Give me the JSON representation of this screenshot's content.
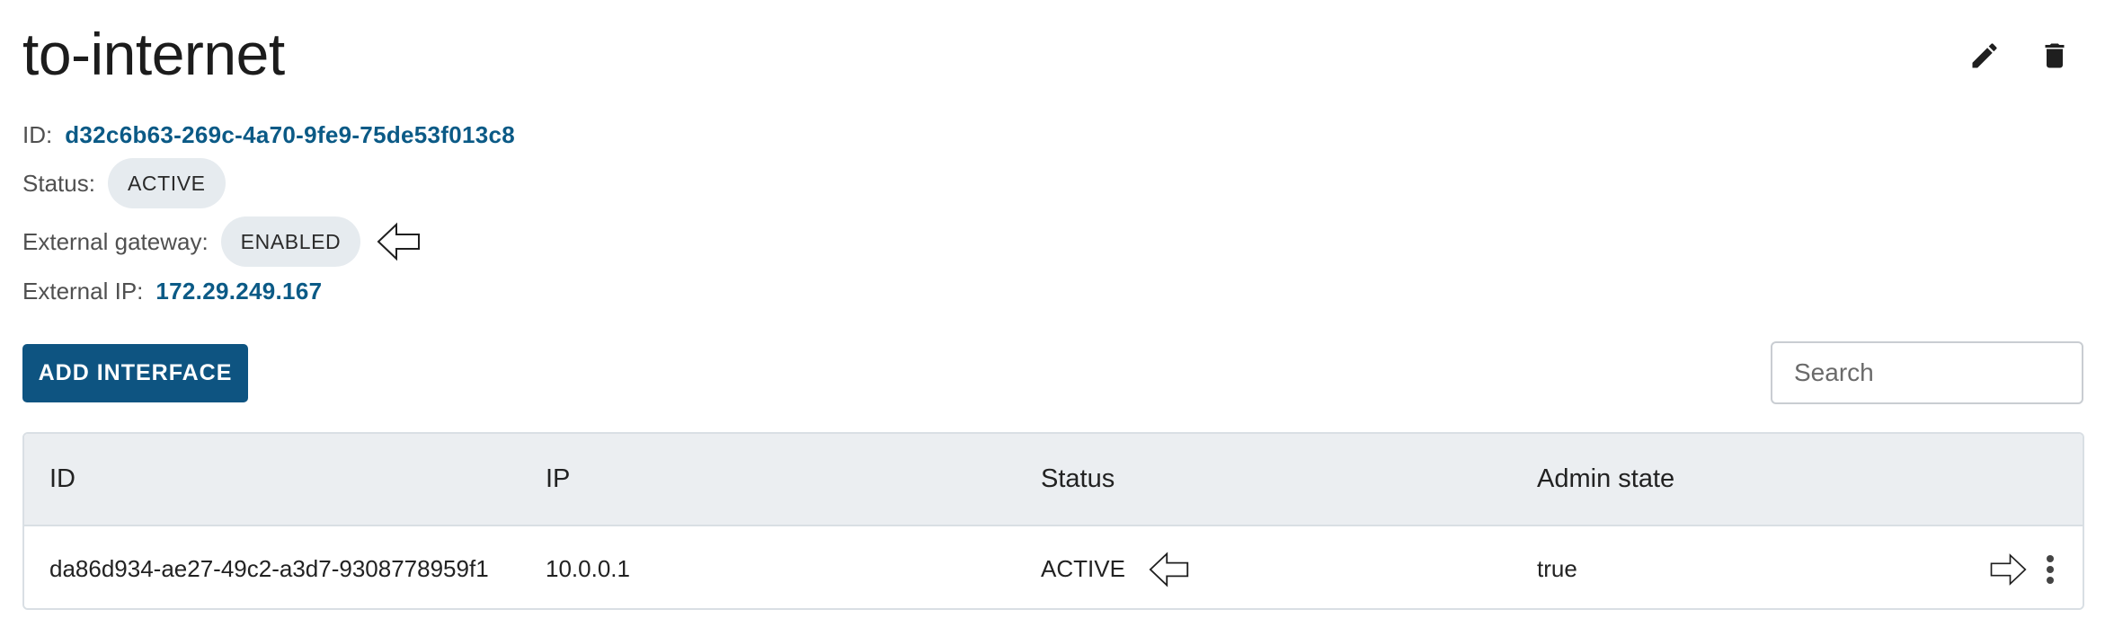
{
  "header": {
    "title": "to-internet",
    "edit_icon": "pencil-icon",
    "delete_icon": "trash-icon"
  },
  "details": {
    "id_label": "ID:",
    "id_value": "d32c6b63-269c-4a70-9fe9-75de53f013c8",
    "status_label": "Status:",
    "status_value": "ACTIVE",
    "gateway_label": "External gateway:",
    "gateway_value": "ENABLED",
    "external_ip_label": "External IP:",
    "external_ip_value": "172.29.249.167"
  },
  "toolbar": {
    "add_interface_label": "ADD INTERFACE",
    "search_placeholder": "Search"
  },
  "table": {
    "columns": [
      "ID",
      "IP",
      "Status",
      "Admin state"
    ],
    "rows": [
      {
        "id": "da86d934-ae27-49c2-a3d7-9308778959f1",
        "ip": "10.0.0.1",
        "status": "ACTIVE",
        "admin_state": "true"
      }
    ]
  },
  "colors": {
    "accent": "#0e5481",
    "link": "#0b5a86",
    "chip_bg": "#e6ebef",
    "table_header_bg": "#ebeef1"
  }
}
